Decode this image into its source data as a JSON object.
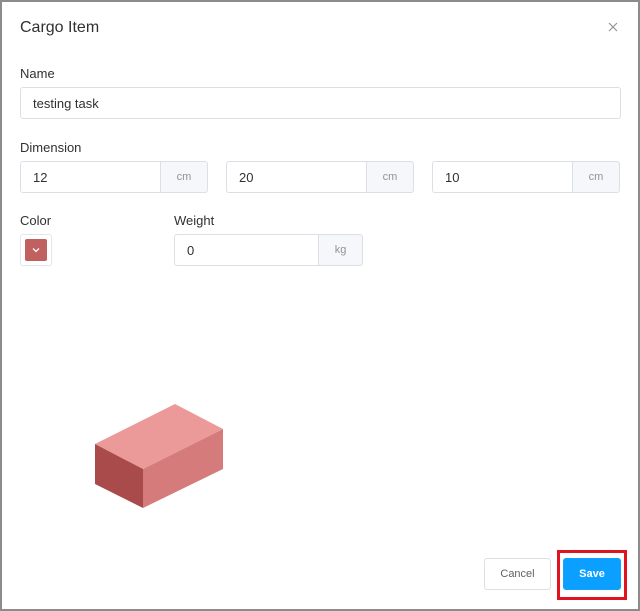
{
  "dialog": {
    "title": "Cargo Item",
    "close_icon": "close-icon"
  },
  "name": {
    "label": "Name",
    "value": "testing task"
  },
  "dimension": {
    "label": "Dimension",
    "length": {
      "value": "12",
      "unit": "cm"
    },
    "width": {
      "value": "20",
      "unit": "cm"
    },
    "height": {
      "value": "10",
      "unit": "cm"
    }
  },
  "color": {
    "label": "Color",
    "value": "#c0605f",
    "icon": "chevron-down-icon"
  },
  "weight": {
    "label": "Weight",
    "value": "0",
    "unit": "kg"
  },
  "preview": {
    "colors": {
      "top": "#ec9a99",
      "right": "#d67b7b",
      "left": "#a84b4a"
    }
  },
  "footer": {
    "cancel_label": "Cancel",
    "save_label": "Save"
  },
  "highlight_color": "#e0141e"
}
